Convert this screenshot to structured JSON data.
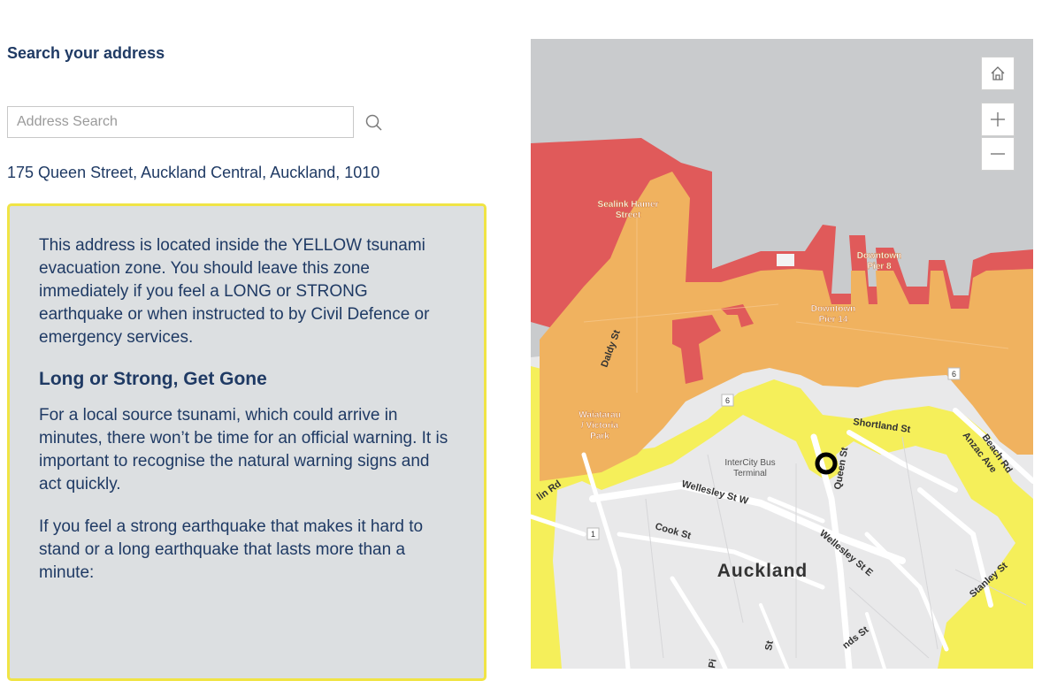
{
  "search": {
    "title": "Search your address",
    "placeholder": "Address Search",
    "search_icon": "search-icon",
    "result_address": "175 Queen Street, Auckland Central, Auckland, 1010"
  },
  "info": {
    "paragraph1": "This address is located inside the YELLOW tsunami evacuation zone. You should leave this zone immediately if you feel a LONG or STRONG earthquake or when instructed to by Civil Defence or emergency services.",
    "heading": "Long or Strong, Get Gone",
    "paragraph2": "For a local source tsunami, which could arrive in minutes, there won’t be time for an official warning. It is important to recognise the natural warning signs and act quickly.",
    "paragraph3": "If you feel a strong earthquake that makes it hard to stand or a long earthquake that lasts more than a minute:"
  },
  "map": {
    "controls": {
      "home_icon": "home-icon",
      "zoom_in_icon": "plus-icon",
      "zoom_out_icon": "minus-icon"
    },
    "labels": {
      "sealink_1": "Sealink Hamer",
      "sealink_2": "Street",
      "pier8_1": "Downtown",
      "pier8_2": "Pier 8",
      "pier14_1": "Downtown",
      "pier14_2": "Pier 14",
      "daldy": "Daldy St",
      "victoria_1": "Waiatarau",
      "victoria_2": "/ Victoria",
      "victoria_3": "Park",
      "shortland": "Shortland St",
      "beach": "Beach Rd",
      "anzac": "Anzac Ave",
      "intercity_1": "InterCity Bus",
      "intercity_2": "Terminal",
      "queen": "Queen St",
      "wellesley_w": "Wellesley St W",
      "wellesley_e": "Wellesley St E",
      "cook": "Cook St",
      "auckland": "Auckland",
      "stanley": "Stanley St",
      "lin_rd": "lin Rd",
      "pi": "Pi",
      "st": "St",
      "nds_st": "nds St",
      "route6a": "6",
      "route6b": "6",
      "route1": "1"
    },
    "colors": {
      "sea": "#c9cbcd",
      "red_zone": "#e05a5a",
      "orange_zone": "#f0b25f",
      "yellow_zone": "#f5ef5a",
      "land": "#e9e9ea",
      "text": "#1f3a64"
    }
  }
}
